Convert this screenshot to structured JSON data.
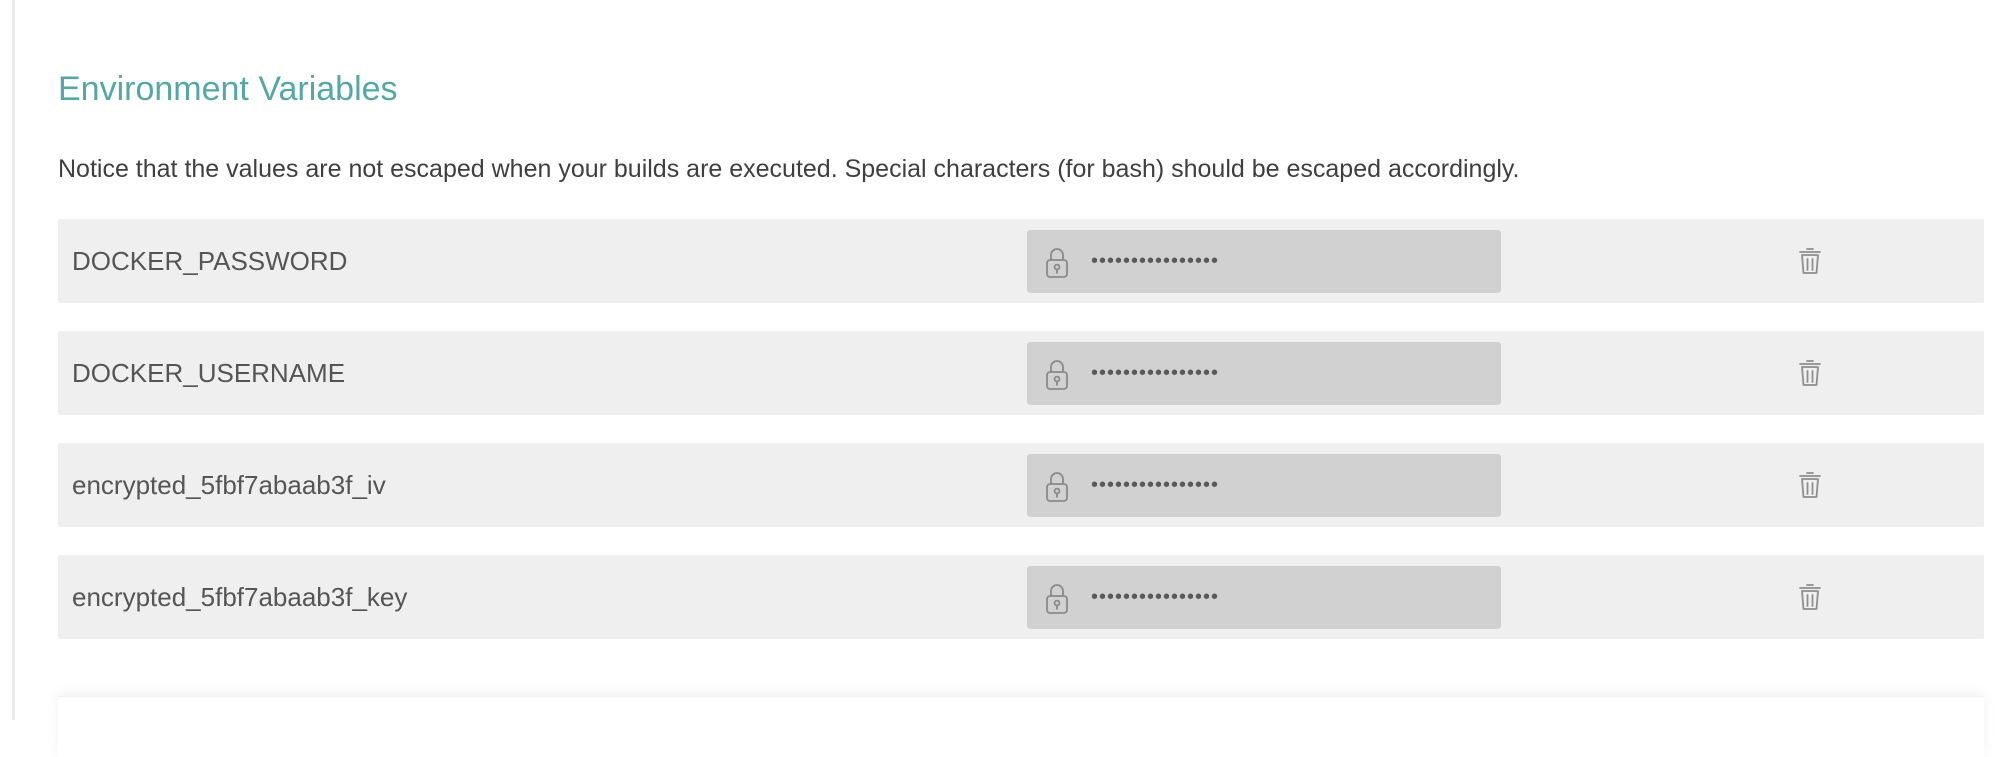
{
  "section": {
    "title": "Environment Variables",
    "notice": "Notice that the values are not escaped when your builds are executed. Special characters (for bash) should be escaped accordingly."
  },
  "env_vars": [
    {
      "name": "DOCKER_PASSWORD",
      "value": "••••••••••••••••"
    },
    {
      "name": "DOCKER_USERNAME",
      "value": "••••••••••••••••"
    },
    {
      "name": "encrypted_5fbf7abaab3f_iv",
      "value": "••••••••••••••••"
    },
    {
      "name": "encrypted_5fbf7abaab3f_key",
      "value": "••••••••••••••••"
    }
  ],
  "icons": {
    "lock": "lock-icon",
    "delete": "trash-icon"
  },
  "colors": {
    "accent": "#53a8a5",
    "row_background": "#efefef",
    "value_background": "#d1d1d1",
    "text": "#3f3f3f"
  }
}
